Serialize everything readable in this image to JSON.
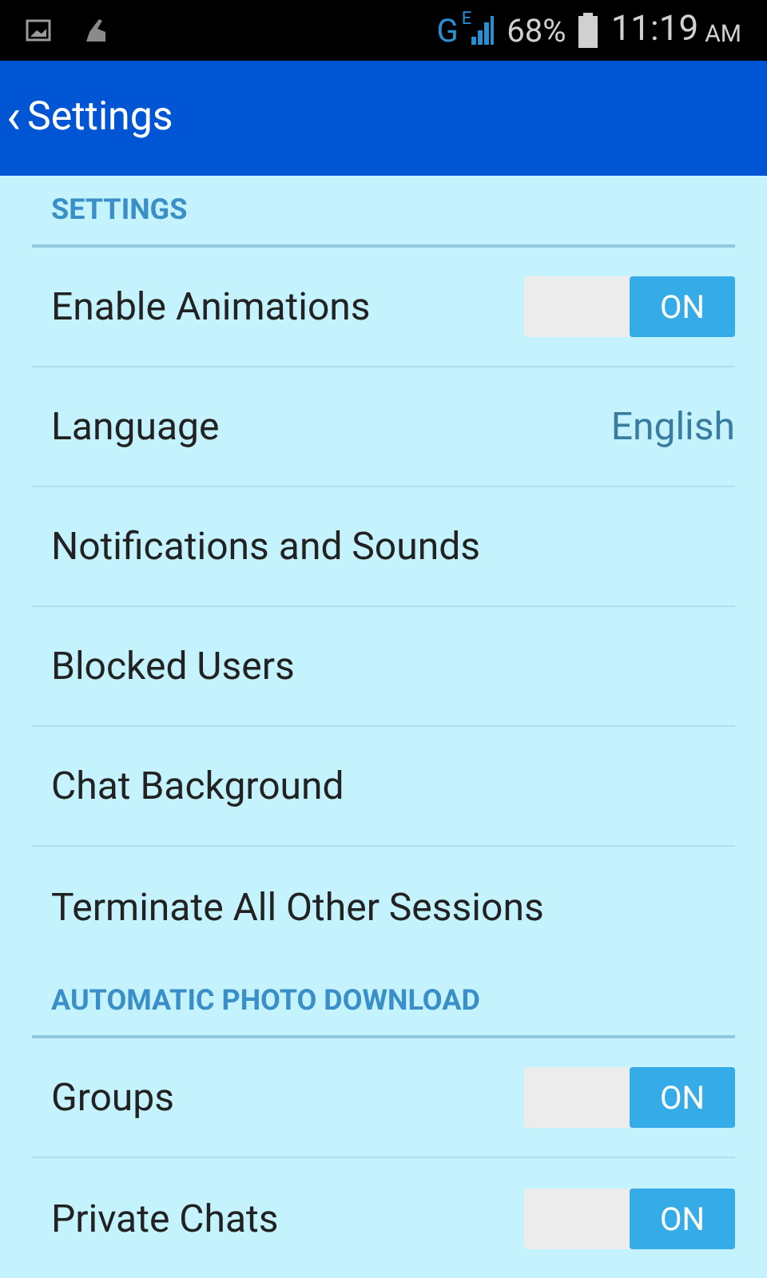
{
  "status_bar": {
    "network": "G",
    "network_sub": "E",
    "battery": "68%",
    "time": "11:19",
    "time_suffix": "AM"
  },
  "app_bar": {
    "back": "‹",
    "title": "Settings"
  },
  "sections": [
    {
      "header": "SETTINGS",
      "items": [
        {
          "kind": "toggle",
          "label": "Enable Animations",
          "on": true,
          "toggle_text": "ON"
        },
        {
          "kind": "value",
          "label": "Language",
          "value": "English"
        },
        {
          "kind": "plain",
          "label": "Notifications and Sounds"
        },
        {
          "kind": "plain",
          "label": "Blocked Users"
        },
        {
          "kind": "plain",
          "label": "Chat Background"
        },
        {
          "kind": "plain",
          "label": "Terminate All Other Sessions"
        }
      ]
    },
    {
      "header": "AUTOMATIC PHOTO DOWNLOAD",
      "items": [
        {
          "kind": "toggle",
          "label": "Groups",
          "on": true,
          "toggle_text": "ON"
        },
        {
          "kind": "toggle",
          "label": "Private Chats",
          "on": true,
          "toggle_text": "ON"
        }
      ]
    }
  ]
}
